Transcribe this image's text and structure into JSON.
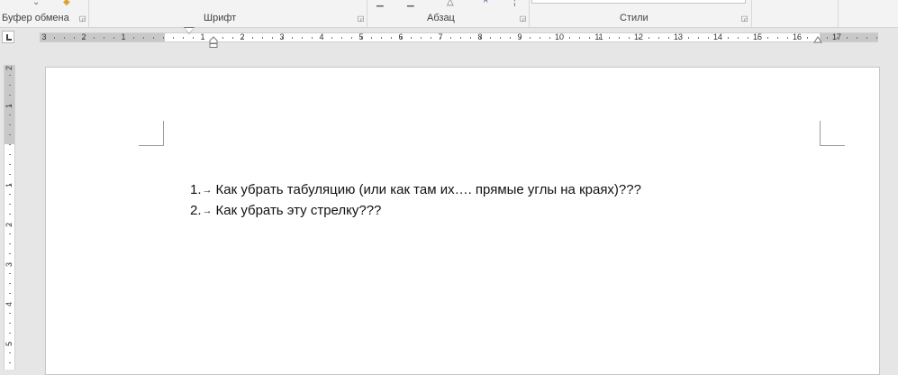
{
  "ribbon": {
    "groups": [
      {
        "label": "Буфер обмена"
      },
      {
        "label": "Шрифт"
      },
      {
        "label": "Абзац"
      },
      {
        "label": "Стили"
      }
    ]
  },
  "ruler": {
    "labels_left": [
      "3",
      "2",
      "1"
    ],
    "labels_right": [
      "1",
      "2",
      "3",
      "4",
      "5",
      "6",
      "7",
      "8",
      "9",
      "10",
      "11",
      "12",
      "13",
      "14",
      "15",
      "16",
      "17"
    ],
    "vertical_labels": [
      "2",
      "1",
      "1",
      "2",
      "3",
      "4",
      "5"
    ]
  },
  "document": {
    "lines": [
      {
        "number": "1.",
        "arrow": "→",
        "text": "Как убрать табуляцию (или как там их…. прямые углы на краях)???"
      },
      {
        "number": "2.",
        "arrow": "→",
        "text": "Как убрать эту стрелку???"
      }
    ]
  }
}
